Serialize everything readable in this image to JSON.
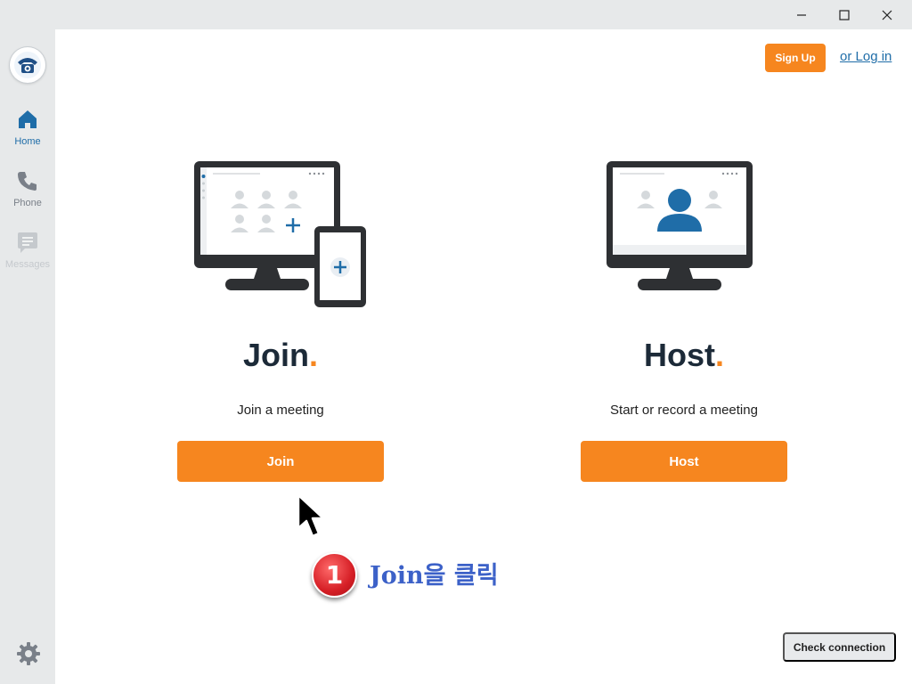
{
  "window": {
    "minimize_icon": "minimize-icon",
    "maximize_icon": "maximize-icon",
    "close_icon": "close-icon"
  },
  "sidebar": {
    "logo_icon": "phone-logo-icon",
    "items": [
      {
        "label": "Home",
        "icon": "home-icon",
        "active": true,
        "color": "#1f6da8"
      },
      {
        "label": "Phone",
        "icon": "phone-icon",
        "active": false,
        "color": "#7a8089"
      },
      {
        "label": "Messages",
        "icon": "messages-icon",
        "active": false,
        "color": "#c5c9cd"
      }
    ],
    "settings_icon": "gear-icon"
  },
  "header": {
    "signup_label": "Sign Up",
    "login_label": "or Log in"
  },
  "cards": {
    "join": {
      "title": "Join",
      "title_dot": ".",
      "subtitle": "Join a meeting",
      "button_label": "Join"
    },
    "host": {
      "title": "Host",
      "title_dot": ".",
      "subtitle": "Start or record a meeting",
      "button_label": "Host"
    }
  },
  "footer": {
    "check_connection_label": "Check connection"
  },
  "annotation": {
    "step_number": "1",
    "text": "Join을 클릭"
  },
  "colors": {
    "accent": "#f6861f",
    "brand_blue": "#1f6da8",
    "dark_navy": "#1c2a38",
    "annotation_blue": "#3c61c8",
    "annotation_red": "#d61f26"
  }
}
